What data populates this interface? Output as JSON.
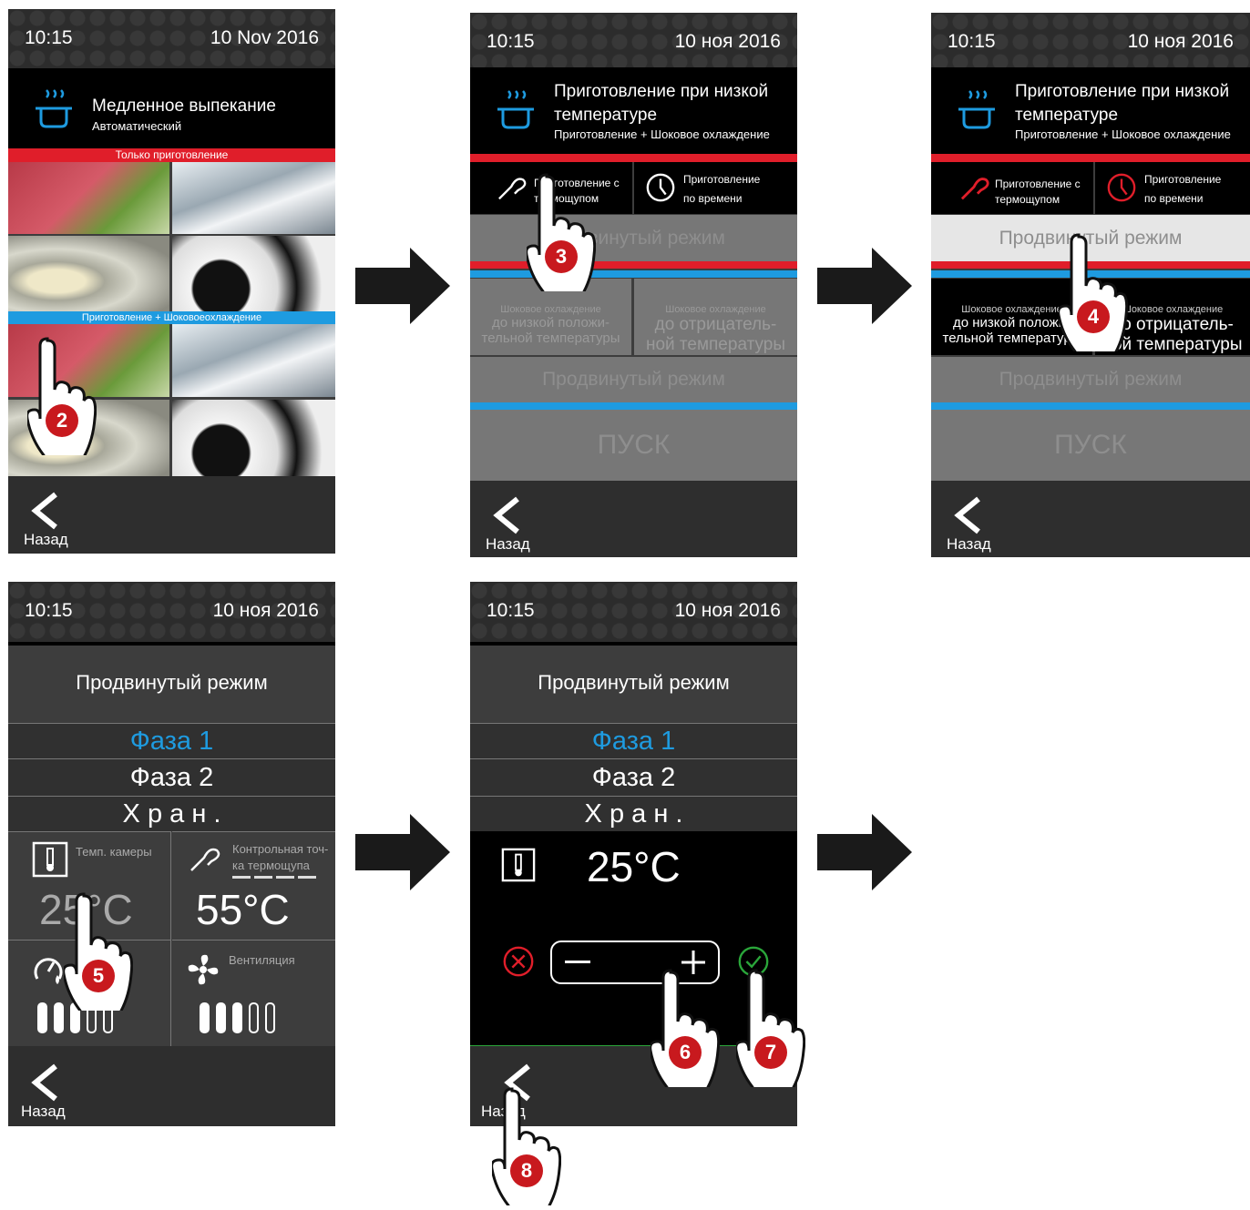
{
  "screens": {
    "s1": {
      "time": "10:15",
      "date": "10  Nov  2016",
      "title": "Медленное выпекание",
      "subtitle": "Автоматический",
      "red_bar": "Только приготовление",
      "blue_bar": "Приготовление + Шоковоеохлаждение",
      "back": "Назад"
    },
    "s2": {
      "time": "10:15",
      "date": "10 ноя 2016",
      "title_l1": "Приготовление при низкой",
      "title_l2": "температуре",
      "subtitle": "Приготовление + Шоковое охлаждение",
      "probe_l1": "Приготовление с",
      "probe_l2": "термощупом",
      "timed_l1": "Приготовление",
      "timed_l2": "по времени",
      "advanced": "Продвинутый режим",
      "chill_small": "Шоковое охлаждение",
      "chill_pos_l1": "до низкой положи-",
      "chill_pos_l2": "тельной температуры",
      "chill_neg_l1": "до отрицатель-",
      "chill_neg_l2": "ной температуры",
      "advanced2": "Продвинутый режим",
      "start": "ПУСК",
      "back": "Назад"
    },
    "s3": {
      "time": "10:15",
      "date": "10 ноя 2016",
      "title_l1": "Приготовление при низкой",
      "title_l2": "температуре",
      "subtitle": "Приготовление + Шоковое охлаждение",
      "probe_l1": "Приготовление с",
      "probe_l2": "термощупом",
      "timed_l1": "Приготовление",
      "timed_l2": "по времени",
      "advanced": "Продвинутый режим",
      "chill_small": "Шоковое охлаждение",
      "chill_pos_l1": "до низкой положи-",
      "chill_pos_l2": "тельной температуры",
      "chill_neg_l1": "до отрицатель-",
      "chill_neg_l2": "ной температуры",
      "advanced2": "Продвинутый режим",
      "start": "ПУСК",
      "back": "Назад"
    },
    "s4": {
      "time": "10:15",
      "date": "10 ноя 2016",
      "title": "Продвинутый режим",
      "phase1": "Фаза 1",
      "phase2": "Фаза 2",
      "hold": "Х р а н .",
      "chamber_label": "Темп. камеры",
      "chamber_value": "25°C",
      "probe_label": "Контрольная точ-ка термощупа",
      "probe_value": "55°C",
      "fan_label": "Вентиляция",
      "humidity_level": 3,
      "fan_level": 3,
      "back": "Назад"
    },
    "s5": {
      "time": "10:15",
      "date": "10 ноя 2016",
      "title": "Продвинутый режим",
      "phase1": "Фаза 1",
      "phase2": "Фаза 2",
      "hold": "Х р а н .",
      "edit_value": "25°C",
      "back": "Назад"
    }
  },
  "steps": [
    "2",
    "3",
    "4",
    "5",
    "6",
    "7",
    "8"
  ],
  "colors": {
    "accent_blue": "#1e9be0",
    "accent_red": "#e01e2a",
    "step_red": "#c8191e",
    "confirm_green": "#2aa63a"
  }
}
